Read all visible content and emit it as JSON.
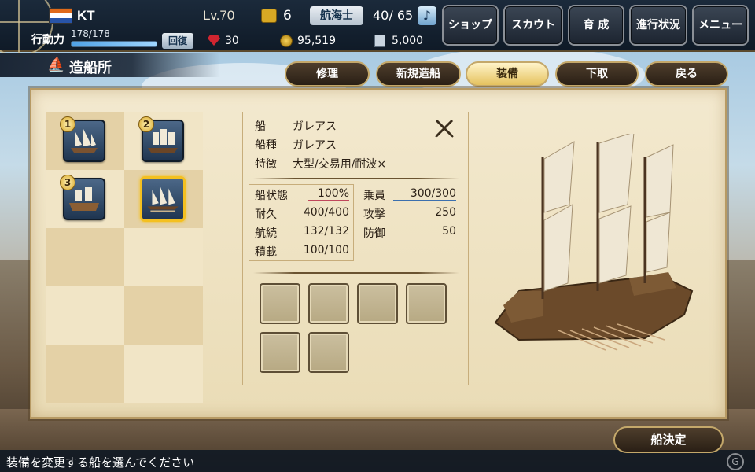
{
  "player": {
    "name": "KT",
    "level": "Lv.70",
    "chest_count": "6",
    "job": "航海士",
    "crew": "40/ 65",
    "action_power_label": "行動力",
    "action_power_value": "178/178",
    "action_power_ratio": 1.0,
    "recover_label": "回復",
    "gems": "30",
    "coins": "95,519",
    "tickets": "5,000"
  },
  "menu": [
    "ショップ",
    "スカウト",
    "育 成",
    "進行状況",
    "メニュー"
  ],
  "section_title": "造船所",
  "actions": {
    "repair": "修理",
    "new_build": "新規造船",
    "equip": "装備",
    "remove": "下取",
    "back": "戻る"
  },
  "ship_slots": [
    {
      "num": "1"
    },
    {
      "num": "2"
    },
    {
      "num": "3"
    },
    {
      "num": ""
    }
  ],
  "ship_info": {
    "ship_label": "船",
    "ship_name": "ガレアス",
    "type_label": "船種",
    "type_value": "ガレアス",
    "feature_label": "特徴",
    "feature_value": "大型/交易用/耐波×",
    "condition_label": "船状態",
    "condition_value": "100%",
    "crew_label": "乗員",
    "crew_value": "300/300",
    "durability_label": "耐久",
    "durability_value": "400/400",
    "attack_label": "攻撃",
    "attack_value": "250",
    "range_label": "航続",
    "range_value": "132/132",
    "defense_label": "防御",
    "defense_value": "50",
    "cargo_label": "積載",
    "cargo_value": "100/100"
  },
  "bottom": {
    "hint": "装備を変更する船を選んでください",
    "decide": "船決定"
  }
}
